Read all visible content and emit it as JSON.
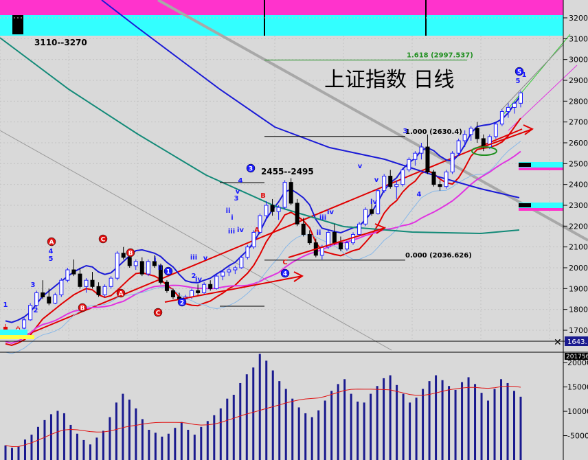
{
  "chart_title": "上证指数  日线",
  "target_range": "3110--3270",
  "range_label": "2455--2495",
  "last_price_tag": "1643.",
  "volume_scale_tag": "201756",
  "fib_levels": [
    {
      "label": "1.618 (2997.537)",
      "value": 2997.537,
      "color": "#1f8f1f"
    },
    {
      "label": "1.000 (2630.4)",
      "value": 2630.4,
      "color": "#000000"
    },
    {
      "label": "0.000 (2036.626)",
      "value": 2036.626,
      "color": "#000000"
    }
  ],
  "price_axis_ticks": [
    3200,
    3100,
    3000,
    2900,
    2800,
    2700,
    2600,
    2500,
    2400,
    2300,
    2200,
    2100,
    2000,
    1900,
    1800,
    1700
  ],
  "price_axis_labels": [
    "3200",
    "3100",
    "3000",
    "2900",
    "2800",
    "2700",
    "2600",
    "2500",
    "2400",
    "2300",
    "2200",
    "2100",
    "2000",
    "1900",
    "1800",
    "1700"
  ],
  "volume_axis_ticks": [
    20000,
    15000,
    10000,
    5000
  ],
  "volume_axis_labels": [
    "20000",
    "15000",
    "10000",
    "-5000"
  ],
  "colors": {
    "background": "#d9d9d9",
    "top_band_magenta": "#ff33cc",
    "top_band_cyan": "#33ffff",
    "up_candle": "#1a1aff",
    "down_candle": "#000000",
    "early_down": "#e60000",
    "ma_blue": "#1a1ad6",
    "ma_teal": "#138a78",
    "ma_magenta": "#e033e0",
    "ma_red": "#e00000",
    "trend_red": "#e00000",
    "trend_gray": "#a8a8a8",
    "label_red": "#e01010",
    "label_blue": "#1a1aff",
    "volume_bar": "#1a1a8f",
    "volume_ma": "#e01010",
    "axis_text": "#000000"
  },
  "wave_labels_red": [
    "A",
    "C",
    "B",
    "A",
    "B",
    "C",
    "B",
    "A",
    "C"
  ],
  "wave_labels_blue_circled": [
    "1",
    "2",
    "3",
    "4",
    "5"
  ],
  "wave_labels_small": [
    "1",
    "2",
    "3",
    "4",
    "5",
    "i",
    "ii",
    "iii",
    "iv",
    "v",
    "i",
    "ii",
    "iii",
    "iv",
    "v",
    "3",
    "4",
    "iv",
    "v",
    "ii",
    "iii",
    "iv",
    "v",
    "3",
    "4",
    "5",
    "1",
    "2"
  ],
  "chart_data": {
    "type": "candlestick",
    "title": "上证指数  日线",
    "xlabel": "",
    "ylabel": "",
    "ylim": [
      1643,
      3240
    ],
    "volume_ylim": [
      0,
      22000
    ],
    "series": [
      {
        "name": "price",
        "ohlc": [
          [
            1715,
            1730,
            1670,
            1685
          ],
          [
            1690,
            1700,
            1660,
            1670
          ],
          [
            1680,
            1720,
            1675,
            1710
          ],
          [
            1710,
            1760,
            1705,
            1750
          ],
          [
            1750,
            1830,
            1745,
            1820
          ],
          [
            1820,
            1890,
            1810,
            1880
          ],
          [
            1880,
            1940,
            1850,
            1860
          ],
          [
            1860,
            1900,
            1820,
            1830
          ],
          [
            1830,
            1880,
            1825,
            1870
          ],
          [
            1870,
            1950,
            1860,
            1940
          ],
          [
            1940,
            2000,
            1930,
            1990
          ],
          [
            1990,
            2040,
            1960,
            1970
          ],
          [
            1970,
            2000,
            1900,
            1910
          ],
          [
            1910,
            1950,
            1880,
            1940
          ],
          [
            1940,
            1980,
            1900,
            1910
          ],
          [
            1910,
            1930,
            1860,
            1870
          ],
          [
            1870,
            1920,
            1860,
            1910
          ],
          [
            1910,
            1960,
            1900,
            1950
          ],
          [
            1950,
            2080,
            1940,
            2070
          ],
          [
            2070,
            2100,
            2040,
            2050
          ],
          [
            2050,
            2060,
            2000,
            2010
          ],
          [
            2010,
            2040,
            1990,
            2030
          ],
          [
            2030,
            2050,
            1960,
            1970
          ],
          [
            1970,
            2040,
            1960,
            2030
          ],
          [
            2030,
            2060,
            2000,
            2010
          ],
          [
            2010,
            2020,
            1920,
            1930
          ],
          [
            1930,
            1940,
            1880,
            1890
          ],
          [
            1890,
            1900,
            1850,
            1860
          ],
          [
            1860,
            1880,
            1840,
            1850
          ],
          [
            1850,
            1870,
            1830,
            1860
          ],
          [
            1860,
            1900,
            1850,
            1890
          ],
          [
            1890,
            1920,
            1870,
            1880
          ],
          [
            1880,
            1930,
            1870,
            1920
          ],
          [
            1920,
            1940,
            1890,
            1900
          ],
          [
            1900,
            1970,
            1895,
            1960
          ],
          [
            1960,
            1990,
            1940,
            1980
          ],
          [
            1980,
            2010,
            1960,
            1990
          ],
          [
            1990,
            2010,
            1970,
            2000
          ],
          [
            2000,
            2060,
            1995,
            2050
          ],
          [
            2050,
            2110,
            2040,
            2100
          ],
          [
            2100,
            2180,
            2090,
            2170
          ],
          [
            2170,
            2260,
            2160,
            2250
          ],
          [
            2250,
            2320,
            2230,
            2300
          ],
          [
            2300,
            2330,
            2250,
            2270
          ],
          [
            2270,
            2300,
            2230,
            2290
          ],
          [
            2290,
            2420,
            2280,
            2410
          ],
          [
            2410,
            2430,
            2300,
            2310
          ],
          [
            2310,
            2330,
            2200,
            2210
          ],
          [
            2210,
            2240,
            2150,
            2160
          ],
          [
            2160,
            2180,
            2110,
            2120
          ],
          [
            2120,
            2140,
            2050,
            2060
          ],
          [
            2060,
            2110,
            2040,
            2100
          ],
          [
            2100,
            2180,
            2090,
            2170
          ],
          [
            2170,
            2210,
            2110,
            2120
          ],
          [
            2120,
            2150,
            2080,
            2090
          ],
          [
            2090,
            2130,
            2080,
            2120
          ],
          [
            2120,
            2170,
            2110,
            2160
          ],
          [
            2160,
            2220,
            2150,
            2210
          ],
          [
            2210,
            2290,
            2200,
            2280
          ],
          [
            2280,
            2330,
            2250,
            2260
          ],
          [
            2260,
            2380,
            2255,
            2370
          ],
          [
            2370,
            2450,
            2360,
            2440
          ],
          [
            2440,
            2470,
            2380,
            2390
          ],
          [
            2390,
            2420,
            2330,
            2400
          ],
          [
            2400,
            2480,
            2390,
            2470
          ],
          [
            2470,
            2530,
            2460,
            2520
          ],
          [
            2520,
            2560,
            2490,
            2550
          ],
          [
            2550,
            2600,
            2520,
            2580
          ],
          [
            2580,
            2640,
            2450,
            2460
          ],
          [
            2460,
            2470,
            2390,
            2400
          ],
          [
            2400,
            2420,
            2370,
            2390
          ],
          [
            2390,
            2470,
            2380,
            2460
          ],
          [
            2460,
            2560,
            2450,
            2550
          ],
          [
            2550,
            2620,
            2540,
            2610
          ],
          [
            2610,
            2660,
            2580,
            2640
          ],
          [
            2640,
            2680,
            2610,
            2670
          ],
          [
            2670,
            2700,
            2600,
            2620
          ],
          [
            2620,
            2640,
            2560,
            2580
          ],
          [
            2580,
            2640,
            2570,
            2630
          ],
          [
            2630,
            2700,
            2620,
            2690
          ],
          [
            2690,
            2760,
            2680,
            2750
          ],
          [
            2750,
            2790,
            2720,
            2770
          ],
          [
            2770,
            2800,
            2740,
            2790
          ],
          [
            2790,
            2850,
            2770,
            2840
          ]
        ]
      },
      {
        "name": "volume",
        "values": [
          3000,
          2500,
          2800,
          4200,
          5200,
          6800,
          8200,
          9400,
          10100,
          9600,
          7200,
          5400,
          4100,
          3200,
          4600,
          6000,
          8800,
          11800,
          13600,
          12400,
          10600,
          8400,
          6200,
          5600,
          4800,
          5400,
          6600,
          7800,
          6200,
          5200,
          6800,
          8000,
          9200,
          10600,
          12600,
          13400,
          15800,
          17600,
          19000,
          21800,
          20400,
          18400,
          16200,
          14600,
          12600,
          10800,
          9600,
          8800,
          10200,
          12200,
          14200,
          15600,
          16600,
          13600,
          12000,
          11800,
          13600,
          15200,
          16800,
          17400,
          15400,
          13600,
          11800,
          12800,
          14600,
          16200,
          17400,
          16400,
          15200,
          14400,
          16000,
          17000,
          15600,
          13800,
          12200,
          14600,
          16600,
          15800,
          14200,
          13000
        ]
      }
    ],
    "moving_average_names": []
  }
}
